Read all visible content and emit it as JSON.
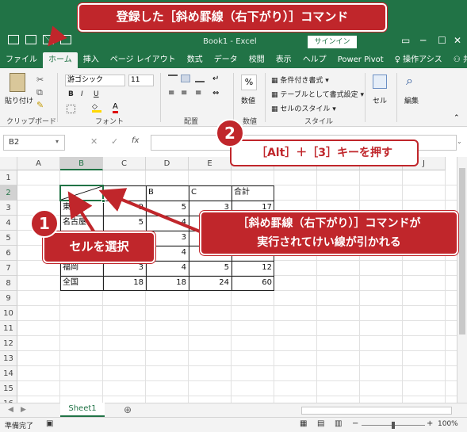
{
  "window": {
    "title": "Book1 - Excel",
    "signin_label": "サインイン",
    "min": "─",
    "max": "☐",
    "close": "✕"
  },
  "tabs": [
    "ファイル",
    "ホーム",
    "挿入",
    "ページ レイアウト",
    "数式",
    "データ",
    "校閲",
    "表示",
    "ヘルプ",
    "Power Pivot",
    "操作アシス",
    "共有"
  ],
  "ribbon": {
    "clipboard": {
      "paste": "貼り付け",
      "label": "クリップボード"
    },
    "font": {
      "name": "游ゴシック",
      "size": "11",
      "bold": "B",
      "italic": "I",
      "underline": "U",
      "label": "フォント"
    },
    "alignment": {
      "label": "配置"
    },
    "number": {
      "percent": "%",
      "label": "数値"
    },
    "styles": {
      "conditional": "条件付き書式",
      "table": "テーブルとして書式設定",
      "cell": "セルのスタイル",
      "label": "スタイル"
    },
    "cells": {
      "label": "セル"
    },
    "edit": {
      "label": "編集"
    }
  },
  "formula_bar": {
    "name_box": "B2",
    "fx": "fx",
    "cancel": "✕",
    "enter": "✓"
  },
  "grid": {
    "columns": [
      "A",
      "B",
      "C",
      "D",
      "E",
      "F",
      "G",
      "H",
      "I",
      "J"
    ],
    "rows": [
      "1",
      "2",
      "3",
      "4",
      "5",
      "6",
      "7",
      "8",
      "9",
      "10",
      "11",
      "12",
      "13",
      "14",
      "15",
      "16",
      "17"
    ],
    "cells": {
      "D2": "B",
      "E2": "C",
      "F2": "合計",
      "B3": "東京",
      "C3": "9",
      "D3": "5",
      "E3": "3",
      "F3": "17",
      "B4": "名古屋",
      "C4": "5",
      "D4": "4",
      "D5": "3",
      "D6": "4",
      "B7": "福岡",
      "C7": "3",
      "D7": "4",
      "E7": "5",
      "F7": "12",
      "B8": "全国",
      "C8": "18",
      "D8": "18",
      "E8": "24",
      "F8": "60"
    }
  },
  "sheet_tabs": {
    "active": "Sheet1",
    "add": "⊕"
  },
  "status": {
    "ready": "準備完了",
    "zoom": "100%"
  },
  "callouts": {
    "top": "登録した［斜め罫線（右下がり）］コマンド",
    "keys": "［Alt］＋［3］キーを押す",
    "result_line1": "［斜め罫線（右下がり）］コマンドが",
    "result_line2": "実行されてけい線が引かれる",
    "select": "セルを選択",
    "badge1": "1",
    "badge2": "2"
  },
  "colors": {
    "excel_green": "#217346",
    "callout_red": "#c0262b"
  }
}
